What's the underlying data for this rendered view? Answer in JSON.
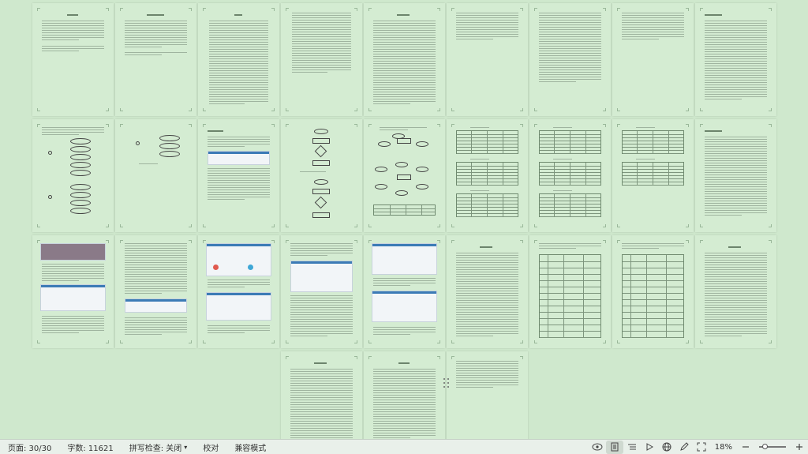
{
  "statusbar": {
    "page": "页面: 30/30",
    "words": "字数: 11621",
    "spell": "拼写检查: 关闭",
    "spell_caret": "▾",
    "proof": "校对",
    "compat": "兼容模式",
    "zoom": "18%"
  },
  "icons": {
    "eye": "eye-icon",
    "page_view": "page-view-icon",
    "list_view": "outline-view-icon",
    "play": "play-icon",
    "web": "web-layout-icon",
    "pen": "pen-icon",
    "fit": "fit-page-icon",
    "minus": "zoom-out-icon",
    "plus": "zoom-in-icon"
  },
  "colors": {
    "page_background": "#d4ecd2",
    "canvas_background": "#cfe8cd",
    "statusbar_background": "#e9f0ea"
  }
}
